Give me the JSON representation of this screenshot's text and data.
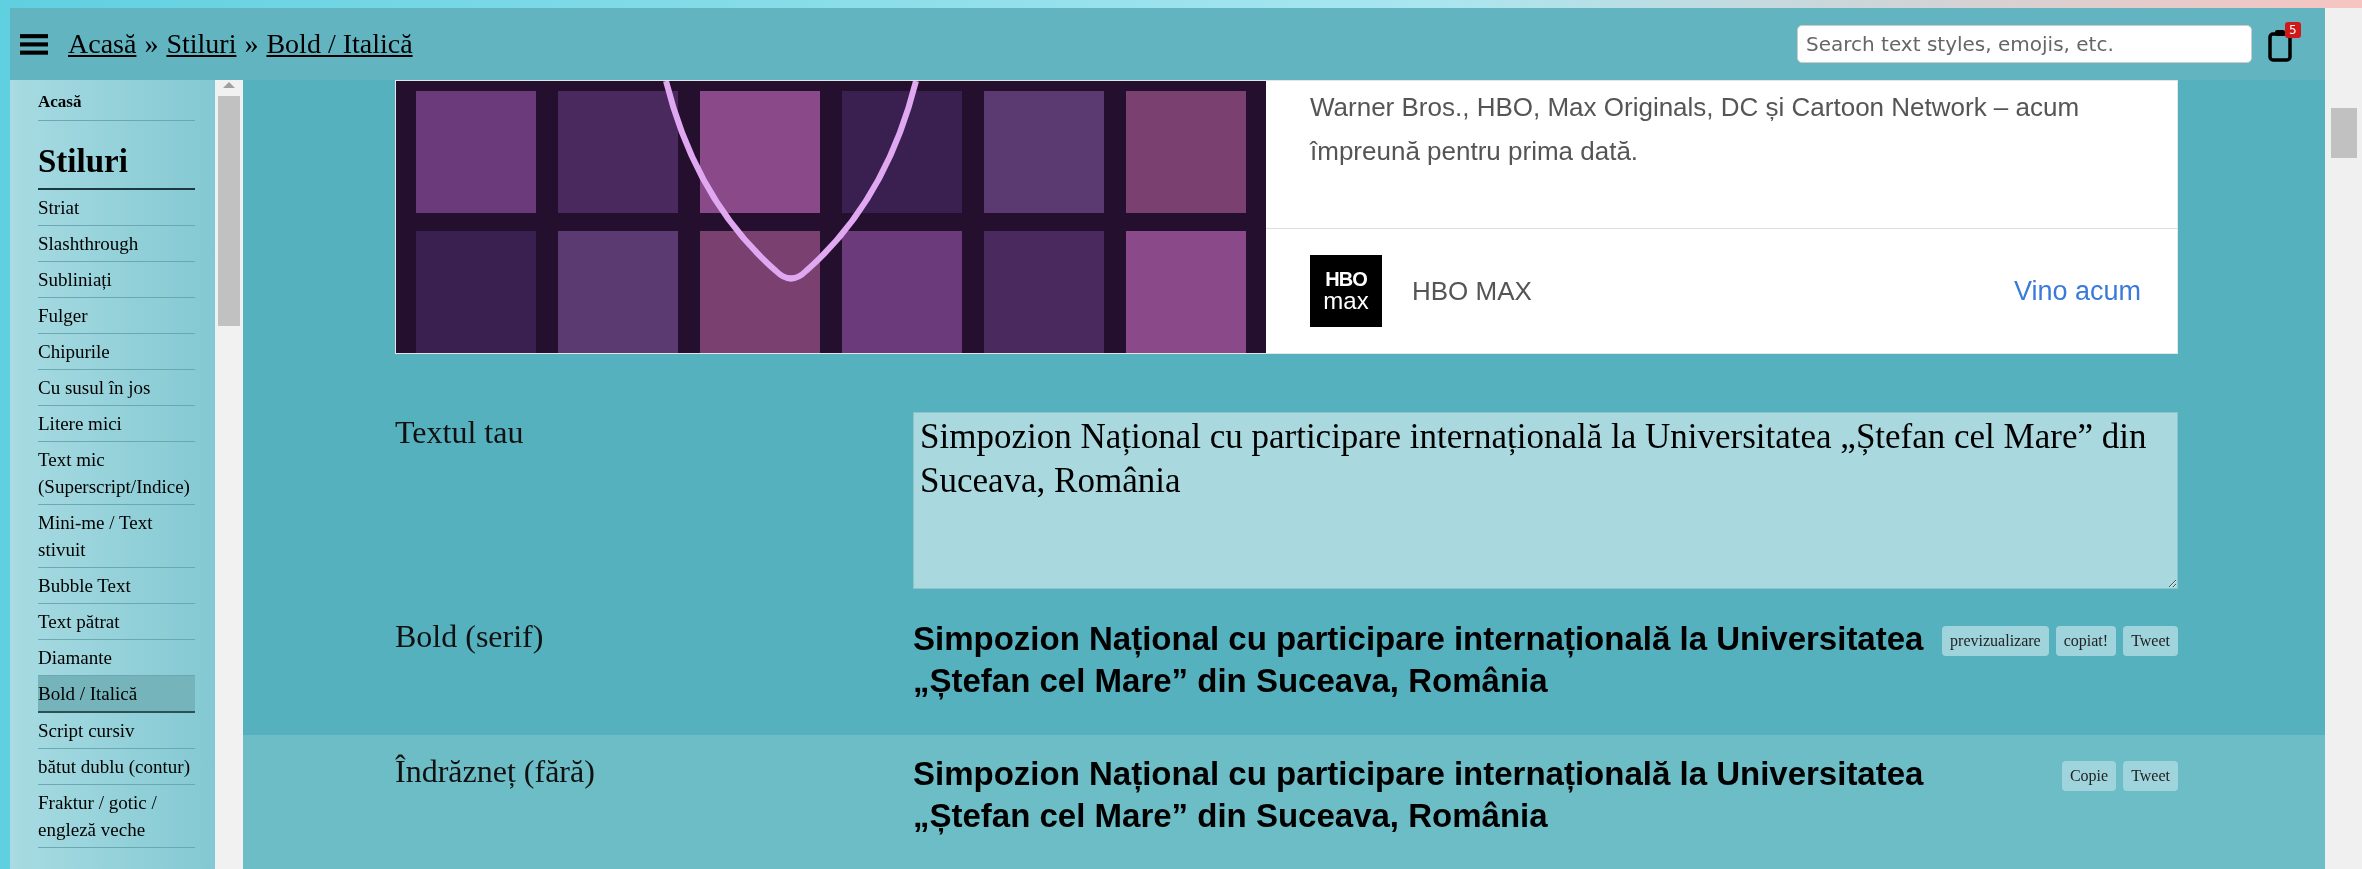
{
  "header": {
    "breadcrumb": [
      {
        "label": "Acasă"
      },
      {
        "label": "Stiluri"
      },
      {
        "label": "Bold / Italică"
      }
    ],
    "separators": [
      "»",
      "»"
    ],
    "search": {
      "placeholder": "Search text styles, emojis, etc."
    },
    "clipboard_badge": "5"
  },
  "sidebar": {
    "home": "Acasă",
    "heading": "Stiluri",
    "items": [
      {
        "label": "Striat",
        "selected": false
      },
      {
        "label": "Slashthrough",
        "selected": false
      },
      {
        "label": "Subliniați",
        "selected": false
      },
      {
        "label": "Fulger",
        "selected": false
      },
      {
        "label": "Chipurile",
        "selected": false
      },
      {
        "label": "Cu susul în jos",
        "selected": false
      },
      {
        "label": "Litere mici",
        "selected": false
      },
      {
        "label": "Text mic (Superscript/Indice)",
        "selected": false
      },
      {
        "label": "Mini-me / Text stivuit",
        "selected": false
      },
      {
        "label": "Bubble Text",
        "selected": false
      },
      {
        "label": "Text pătrat",
        "selected": false
      },
      {
        "label": "Diamante",
        "selected": false
      },
      {
        "label": "Bold / Italică",
        "selected": true
      },
      {
        "label": "Script cursiv",
        "selected": false
      },
      {
        "label": "bătut dublu (contur)",
        "selected": false
      },
      {
        "label": "Fraktur / gotic / engleză veche",
        "selected": false
      }
    ]
  },
  "ad": {
    "text": "Warner Bros., HBO, Max Originals, DC și Cartoon Network – acum împreună pentru prima dată.",
    "logo": [
      "HBO",
      "max"
    ],
    "brand": "HBO MAX",
    "cta": "Vino acum"
  },
  "input": {
    "label": "Textul tau",
    "value": "Simpozion Național cu participare internațională la Universitatea „Ștefan cel Mare” din Suceava, România"
  },
  "outputs": [
    {
      "label": "Bold (serif)",
      "text": "Simpozion Național cu participare internațională la Universitatea „Ștefan cel Mare” din Suceava, România",
      "buttons": [
        "previzualizare",
        "copiat!",
        "Tweet"
      ]
    },
    {
      "label": "Îndrăzneț (fără)",
      "text": "Simpozion Național cu participare internațională la Universitatea „Ștefan cel Mare” din Suceava, România",
      "buttons": [
        "Copie",
        "Tweet"
      ]
    }
  ]
}
